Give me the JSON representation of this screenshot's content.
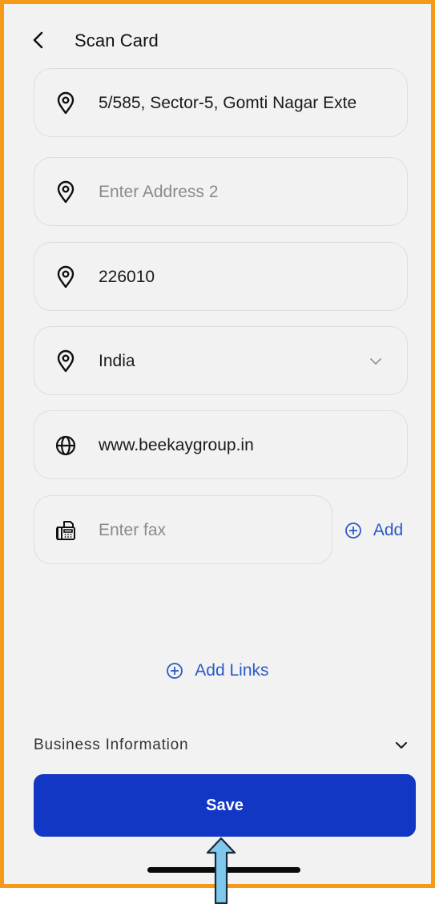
{
  "header": {
    "title": "Scan Card",
    "back_icon": "chevron-left-icon"
  },
  "fields": {
    "address1": {
      "value": "5/585, Sector-5, Gomti Nagar Exte",
      "icon": "location-pin-icon"
    },
    "address2": {
      "placeholder": "Enter Address 2",
      "icon": "location-pin-icon"
    },
    "pincode": {
      "value": "226010",
      "icon": "location-pin-icon"
    },
    "country": {
      "value": "India",
      "icon": "location-pin-icon"
    },
    "website": {
      "value": "www.beekaygroup.in",
      "icon": "globe-icon"
    },
    "fax": {
      "placeholder": "Enter fax",
      "icon": "fax-icon"
    }
  },
  "add_label": "Add",
  "add_links_label": "Add Links",
  "business_section": {
    "label": "Business Information"
  },
  "save_label": "Save",
  "colors": {
    "accent": "#2a5ac8",
    "save_button": "#1237c4",
    "frame_border": "#f59a16",
    "arrow": "#7ec8ec"
  }
}
